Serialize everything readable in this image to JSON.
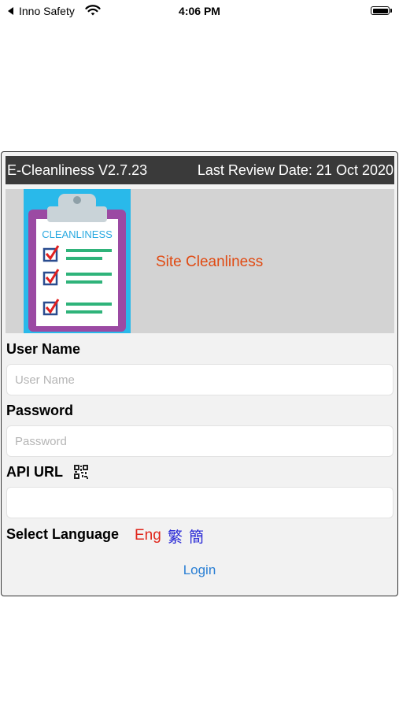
{
  "status_bar": {
    "back_app": "Inno Safety",
    "time": "4:06 PM"
  },
  "header": {
    "app_version": "E-Cleanliness V2.7.23",
    "last_review": "Last Review Date: 21 Oct 2020"
  },
  "banner": {
    "image_caption": "CLEANLINESS",
    "title": "Site Cleanliness"
  },
  "form": {
    "username_label": "User Name",
    "username_placeholder": "User Name",
    "username_value": "",
    "password_label": "Password",
    "password_placeholder": "Password",
    "password_value": "",
    "api_url_label": "API URL",
    "api_url_value": "",
    "language_label": "Select Language",
    "languages": [
      "Eng",
      "繁",
      "簡"
    ],
    "selected_language": "Eng",
    "login_label": "Login"
  },
  "colors": {
    "banner_title": "#e04a12",
    "language_selected": "#e0261b",
    "language_other": "#2828d6",
    "link": "#2a7fd4",
    "header_bg": "#3a3a3a"
  }
}
